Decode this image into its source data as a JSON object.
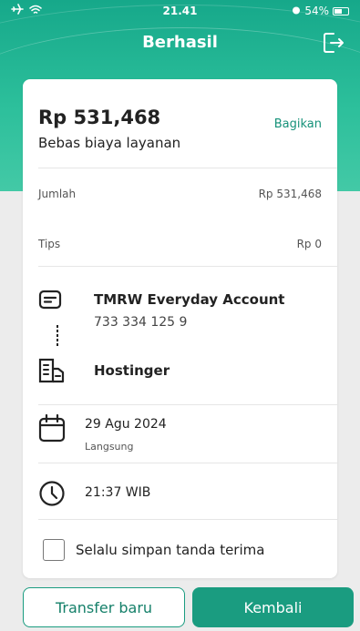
{
  "status_bar": {
    "time": "21.41",
    "battery": "54%"
  },
  "header": {
    "title": "Berhasil"
  },
  "summary": {
    "amount": "Rp 531,468",
    "share_label": "Bagikan",
    "fee_note": "Bebas biaya layanan"
  },
  "breakdown": [
    {
      "label": "Jumlah",
      "value": "Rp 531,468"
    },
    {
      "label": "Tips",
      "value": "Rp 0"
    }
  ],
  "transfer": {
    "source_name": "TMRW Everyday Account",
    "source_number": "733 334 125 9",
    "destination_name": "Hostinger"
  },
  "schedule": {
    "date": "29 Agu 2024",
    "frequency": "Langsung",
    "time": "21:37 WIB"
  },
  "receipt_option": {
    "label": "Selalu simpan tanda terima",
    "checked": false
  },
  "actions": {
    "new_transfer": "Transfer baru",
    "back": "Kembali"
  },
  "colors": {
    "accent": "#1a9c80",
    "header_bg": "#2cbf9b"
  }
}
